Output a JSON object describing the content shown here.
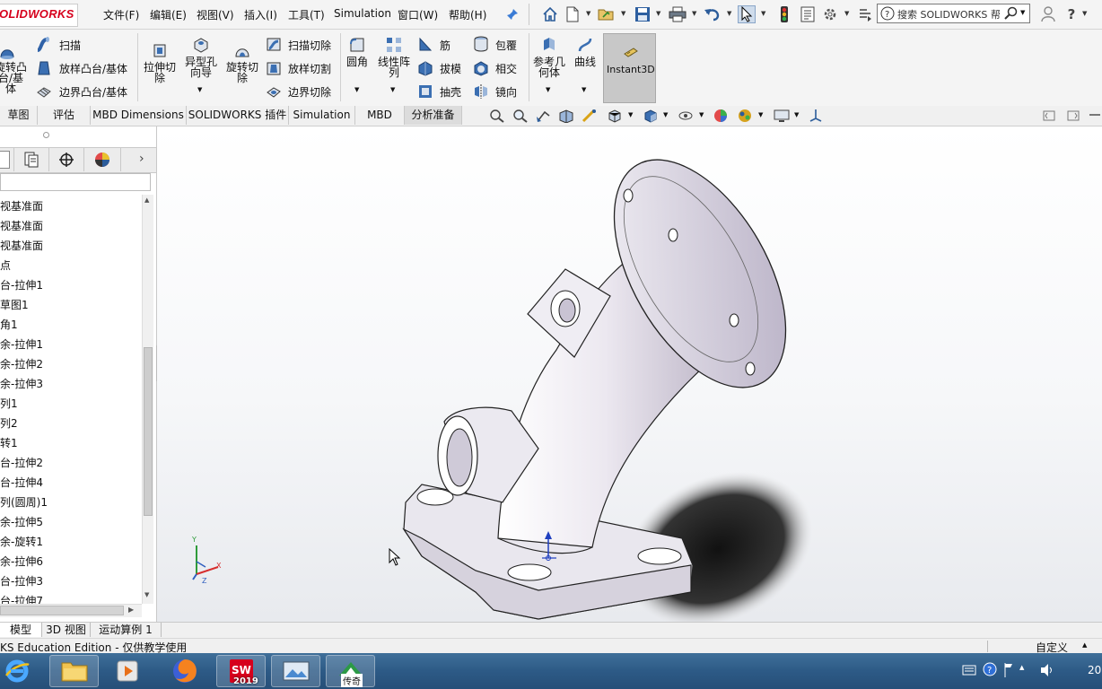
{
  "app": {
    "logo_text": "SOLIDWORKS",
    "brand_color": "#d6001c"
  },
  "menu": [
    {
      "label": "文件(F)"
    },
    {
      "label": "编辑(E)"
    },
    {
      "label": "视图(V)"
    },
    {
      "label": "插入(I)"
    },
    {
      "label": "工具(T)"
    },
    {
      "label": "Simulation"
    },
    {
      "label": "窗口(W)"
    },
    {
      "label": "帮助(H)"
    }
  ],
  "toolbar_icons": [
    "pin-icon",
    "home-icon",
    "new-document-icon",
    "open-icon",
    "save-icon",
    "print-icon",
    "undo-icon",
    "select-pointer-icon",
    "traffic-light-icon",
    "file-properties-icon",
    "options-gear-icon",
    "display-pane-icon"
  ],
  "search": {
    "placeholder": "搜索 SOLIDWORKS 帮"
  },
  "user_icons": [
    "user-icon",
    "help-icon"
  ],
  "commands": {
    "revolve_boss": "旋转凸台/基体",
    "sweep": "扫描",
    "loft_boss": "放样凸台/基体",
    "boundary_boss": "边界凸台/基体",
    "extruded_cut": "拉伸切除",
    "hole_wizard": "异型孔向导",
    "revolved_cut": "旋转切除",
    "swept_cut": "扫描切除",
    "lofted_cut": "放样切割",
    "boundary_cut": "边界切除",
    "fillet": "圆角",
    "linear_pattern": "线性阵列",
    "rib": "筋",
    "draft": "拔模",
    "shell": "抽壳",
    "wrap": "包覆",
    "intersect": "相交",
    "mirror": "镜向",
    "reference_geometry": "参考几何体",
    "curves": "曲线",
    "instant3d": "Instant3D"
  },
  "tabs": [
    {
      "label": "草图"
    },
    {
      "label": "评估"
    },
    {
      "label": "MBD Dimensions"
    },
    {
      "label": "SOLIDWORKS 插件"
    },
    {
      "label": "Simulation"
    },
    {
      "label": "MBD"
    },
    {
      "label": "分析准备"
    }
  ],
  "feature_tree": [
    "视基准面",
    "视基准面",
    "视基准面",
    "点",
    "台-拉伸1",
    "草图1",
    "角1",
    "余-拉伸1",
    "余-拉伸2",
    "余-拉伸3",
    "列1",
    "列2",
    "转1",
    "台-拉伸2",
    "台-拉伸4",
    "列(圆周)1",
    "余-拉伸5",
    "余-旋转1",
    "余-拉伸6",
    "台-拉伸3",
    "台-拉伸7"
  ],
  "bottom_tabs": [
    {
      "label": "模型"
    },
    {
      "label": "3D 视图"
    },
    {
      "label": "运动算例 1"
    }
  ],
  "status": {
    "edition": "KS Education Edition - 仅供教学使用",
    "custom": "自定义"
  },
  "taskbar": {
    "apps": [
      "internet-explorer-icon",
      "file-explorer-icon",
      "media-player-icon",
      "firefox-icon",
      "solidworks-2019-icon",
      "photo-viewer-icon",
      "chuanqi-icon"
    ],
    "sw_label": "2019",
    "chuanqi_label": "传奇",
    "clock": "20"
  },
  "triad": {
    "x": "X",
    "y": "Y",
    "z": "Z"
  }
}
